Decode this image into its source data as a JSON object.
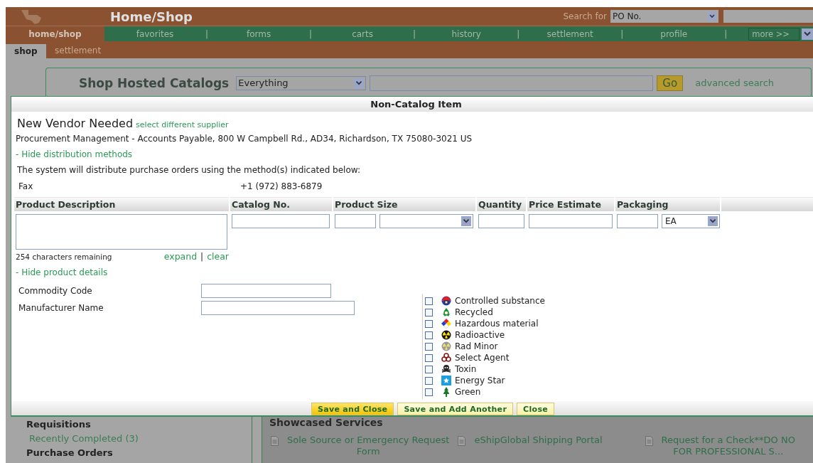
{
  "header": {
    "title": "Home/Shop",
    "search_label": "Search for",
    "search_value": "PO No."
  },
  "nav": {
    "tabs": [
      {
        "label": "home/shop",
        "selected": true
      },
      {
        "label": "favorites",
        "selected": false
      },
      {
        "label": "forms",
        "selected": false
      },
      {
        "label": "carts",
        "selected": false
      },
      {
        "label": "history",
        "selected": false
      },
      {
        "label": "settlement",
        "selected": false
      },
      {
        "label": "profile",
        "selected": false
      }
    ],
    "separator": "|",
    "more": "more >>"
  },
  "subtabs": [
    {
      "label": "shop",
      "selected": true
    },
    {
      "label": "settlement",
      "selected": false
    }
  ],
  "catalog_search": {
    "title": "Shop Hosted Catalogs",
    "scope": "Everything",
    "button": "Go",
    "link": "advanced search"
  },
  "dialog": {
    "title": "Non-Catalog Item",
    "vendor": "New Vendor Needed",
    "vendor_link": "select different supplier",
    "address": "Procurement Management - Accounts Payable, 800 W Campbell Rd., AD34, Richardson, TX 75080-3021 US",
    "distribution_toggle": "- Hide distribution methods",
    "distribution_note": "The system will distribute purchase orders using the method(s) indicated below:",
    "methods": [
      {
        "method": "Fax",
        "value": "+1 (972) 883-6879"
      }
    ],
    "columns": [
      "Product Description",
      "Catalog No.",
      "Product Size",
      "Quantity",
      "Price Estimate",
      "Packaging"
    ],
    "packaging_unit": "EA",
    "remaining": "254 characters remaining",
    "expand": "expand",
    "separator": "|",
    "clear": "clear",
    "details_toggle": "- Hide product details",
    "fields": [
      {
        "label": "Commodity Code"
      },
      {
        "label": "Manufacturer Name"
      }
    ],
    "flags": [
      {
        "label": "Controlled substance",
        "kind": "lock",
        "checked": false
      },
      {
        "label": "Recycled",
        "kind": "recycle",
        "checked": false
      },
      {
        "label": "Hazardous material",
        "kind": "hazard",
        "checked": false
      },
      {
        "label": "Radioactive",
        "kind": "radiation",
        "checked": false
      },
      {
        "label": "Rad Minor",
        "kind": "radminor",
        "checked": false
      },
      {
        "label": "Select Agent",
        "kind": "biohazard",
        "checked": false
      },
      {
        "label": "Toxin",
        "kind": "skull",
        "checked": false
      },
      {
        "label": "Energy Star",
        "kind": "star",
        "checked": false
      },
      {
        "label": "Green",
        "kind": "tree",
        "checked": false
      }
    ],
    "buttons": [
      "Save and Close",
      "Save and Add Another",
      "Close"
    ]
  },
  "background": {
    "left": [
      {
        "kind": "heading",
        "text": "Requisitions"
      },
      {
        "kind": "link",
        "text": "Recently Completed (3)"
      },
      {
        "kind": "heading",
        "text": "Purchase Orders"
      }
    ],
    "services_title": "Showcased Services",
    "services": [
      {
        "lines": [
          "Sole Source or Emergency Request",
          "Form"
        ]
      },
      {
        "lines": [
          "eShipGlobal Shipping Portal"
        ]
      },
      {
        "lines": [
          "Request for a Check**DO NO",
          "FOR PROFESSIONAL S..."
        ]
      }
    ]
  }
}
